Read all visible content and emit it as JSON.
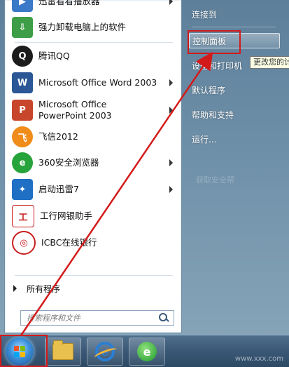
{
  "start_menu": {
    "programs": [
      {
        "label": "迅雷看看播放器",
        "icon": "xunlei-player-icon",
        "color": "#3a78c8",
        "glyph": "▶",
        "has_submenu": true
      },
      {
        "label": "强力卸载电脑上的软件",
        "icon": "uninstall-icon",
        "color": "#3d9e47",
        "glyph": "⇩",
        "has_submenu": false
      },
      {
        "label": "腾讯QQ",
        "icon": "qq-penguin-icon",
        "color": "#1c1c1c",
        "glyph": "Q",
        "has_submenu": false
      },
      {
        "label": "Microsoft Office Word 2003",
        "icon": "word-icon",
        "color": "#2b5797",
        "glyph": "W",
        "has_submenu": true
      },
      {
        "label": "Microsoft Office PowerPoint 2003",
        "icon": "powerpoint-icon",
        "color": "#c8462b",
        "glyph": "P",
        "has_submenu": true
      },
      {
        "label": "飞信2012",
        "icon": "fetion-icon",
        "color": "#f08c1a",
        "glyph": "飞",
        "has_submenu": false
      },
      {
        "label": "360安全浏览器",
        "icon": "360-browser-icon",
        "color": "#27a33b",
        "glyph": "e",
        "has_submenu": true
      },
      {
        "label": "启动迅雷7",
        "icon": "thunder-icon",
        "color": "#1f6fc4",
        "glyph": "✦",
        "has_submenu": true
      },
      {
        "label": "工行网银助手",
        "icon": "icbc-helper-icon",
        "color": "#c81e1e",
        "glyph": "工",
        "has_submenu": false
      },
      {
        "label": "ICBC在线银行",
        "icon": "icbc-logo-icon",
        "color": "#c81e1e",
        "glyph": "◎",
        "has_submenu": false
      }
    ],
    "all_programs_label": "所有程序",
    "search_placeholder": "搜索程序和文件",
    "right_items": [
      {
        "label": "连接到"
      },
      {
        "label": "控制面板"
      },
      {
        "label": "设备和打印机"
      },
      {
        "label": "默认程序"
      },
      {
        "label": "帮助和支持"
      },
      {
        "label": "运行..."
      }
    ],
    "tooltip": "更改您的计",
    "faint_right_text": "获取安全帮"
  },
  "taskbar": {
    "items": [
      {
        "name": "explorer",
        "icon": "folder-icon"
      },
      {
        "name": "ie",
        "icon": "ie-icon"
      },
      {
        "name": "360-browser",
        "icon": "360-browser-icon"
      }
    ]
  },
  "watermark": "www.xxx.com",
  "colors": {
    "annotation_red": "#d31a1a",
    "taskbar": "#3a5876",
    "menu_right_pane": "#6d8fa8"
  }
}
